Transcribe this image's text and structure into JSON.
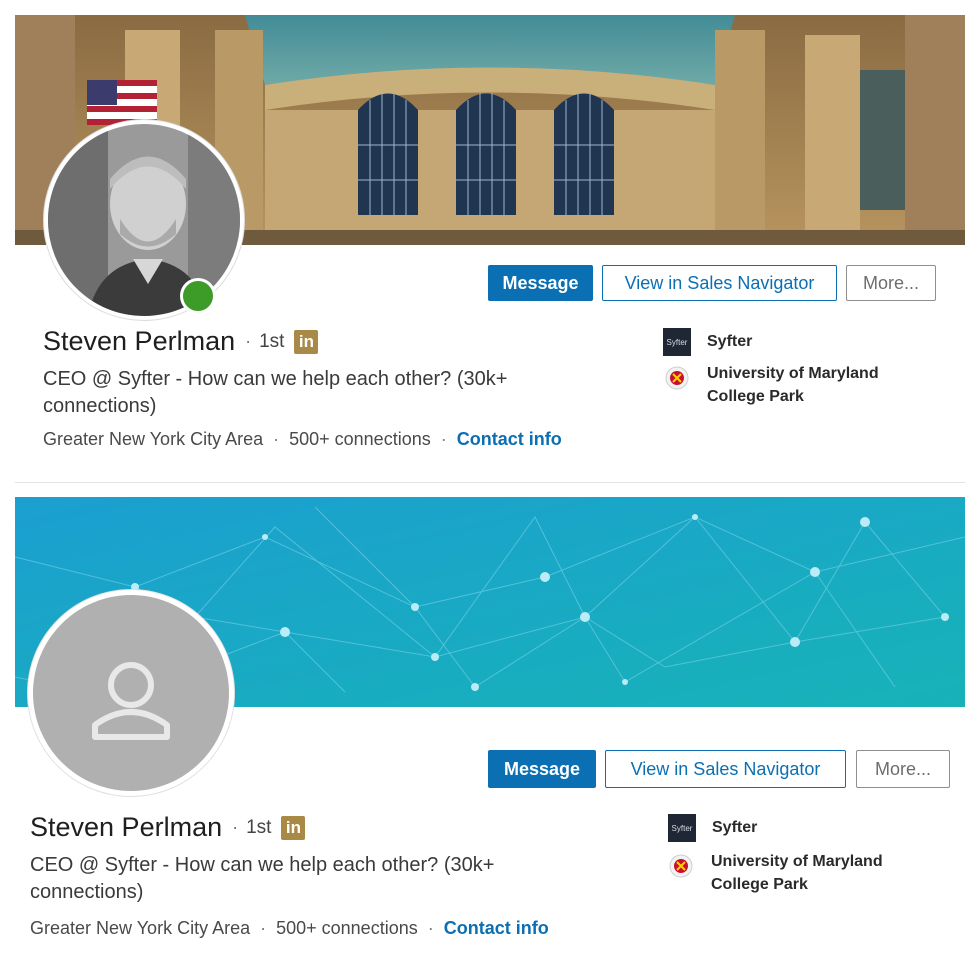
{
  "profiles": [
    {
      "name": "Steven Perlman",
      "degree": "1st",
      "linkedin_badge": "in",
      "headline": "CEO @ Syfter - How can we help each other? (30k+ connections)",
      "location": "Greater New York City Area",
      "connections": "500+ connections",
      "contact_info": "Contact info",
      "buttons": {
        "message": "Message",
        "sales_navigator": "View in Sales Navigator",
        "more": "More..."
      },
      "company": {
        "logo_text": "Syfter",
        "name": "Syfter"
      },
      "education": {
        "line1": "University of Maryland",
        "line2": "College Park"
      },
      "online": true,
      "banner": "grand-central-terminal-photo",
      "avatar": "profile-photo"
    },
    {
      "name": "Steven Perlman",
      "degree": "1st",
      "linkedin_badge": "in",
      "headline": "CEO @ Syfter - How can we help each other? (30k+ connections)",
      "location": "Greater New York City Area",
      "connections": "500+ connections",
      "contact_info": "Contact info",
      "buttons": {
        "message": "Message",
        "sales_navigator": "View in Sales Navigator",
        "more": "More..."
      },
      "company": {
        "logo_text": "Syfter",
        "name": "Syfter"
      },
      "education": {
        "line1": "University of Maryland",
        "line2": "College Park"
      },
      "online": false,
      "banner": "default-network-banner",
      "avatar": "default-person-icon"
    }
  ],
  "colors": {
    "primary": "#0b6fb4",
    "online": "#3c9c27",
    "badge_gold": "#a88a46",
    "banner_teal": "#1aa2cd"
  }
}
